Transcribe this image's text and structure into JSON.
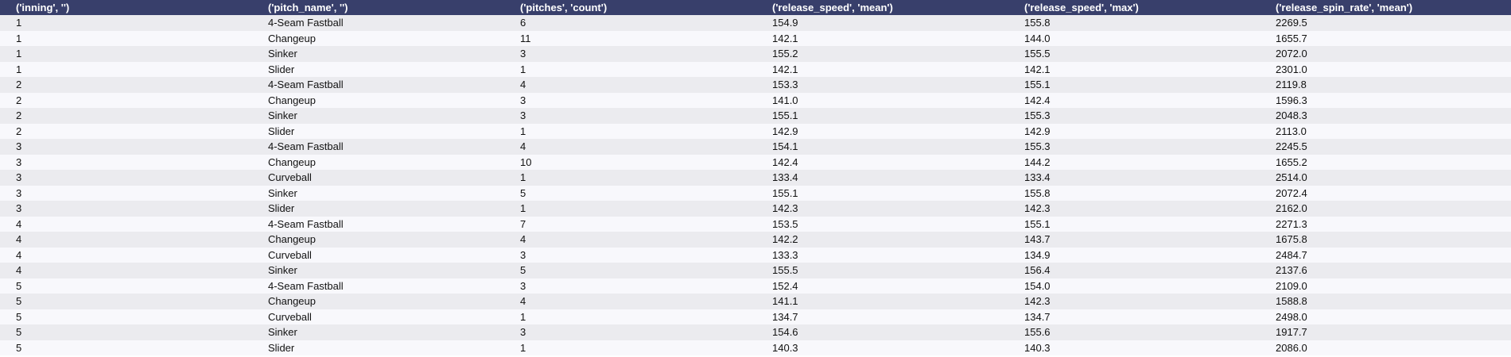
{
  "table": {
    "columns": [
      "('inning', '')",
      "('pitch_name', '')",
      "('pitches', 'count')",
      "('release_speed', 'mean')",
      "('release_speed', 'max')",
      "('release_spin_rate', 'mean')"
    ],
    "rows": [
      [
        "1",
        "4-Seam Fastball",
        "6",
        "154.9",
        "155.8",
        "2269.5"
      ],
      [
        "1",
        "Changeup",
        "11",
        "142.1",
        "144.0",
        "1655.7"
      ],
      [
        "1",
        "Sinker",
        "3",
        "155.2",
        "155.5",
        "2072.0"
      ],
      [
        "1",
        "Slider",
        "1",
        "142.1",
        "142.1",
        "2301.0"
      ],
      [
        "2",
        "4-Seam Fastball",
        "4",
        "153.3",
        "155.1",
        "2119.8"
      ],
      [
        "2",
        "Changeup",
        "3",
        "141.0",
        "142.4",
        "1596.3"
      ],
      [
        "2",
        "Sinker",
        "3",
        "155.1",
        "155.3",
        "2048.3"
      ],
      [
        "2",
        "Slider",
        "1",
        "142.9",
        "142.9",
        "2113.0"
      ],
      [
        "3",
        "4-Seam Fastball",
        "4",
        "154.1",
        "155.3",
        "2245.5"
      ],
      [
        "3",
        "Changeup",
        "10",
        "142.4",
        "144.2",
        "1655.2"
      ],
      [
        "3",
        "Curveball",
        "1",
        "133.4",
        "133.4",
        "2514.0"
      ],
      [
        "3",
        "Sinker",
        "5",
        "155.1",
        "155.8",
        "2072.4"
      ],
      [
        "3",
        "Slider",
        "1",
        "142.3",
        "142.3",
        "2162.0"
      ],
      [
        "4",
        "4-Seam Fastball",
        "7",
        "153.5",
        "155.1",
        "2271.3"
      ],
      [
        "4",
        "Changeup",
        "4",
        "142.2",
        "143.7",
        "1675.8"
      ],
      [
        "4",
        "Curveball",
        "3",
        "133.3",
        "134.9",
        "2484.7"
      ],
      [
        "4",
        "Sinker",
        "5",
        "155.5",
        "156.4",
        "2137.6"
      ],
      [
        "5",
        "4-Seam Fastball",
        "3",
        "152.4",
        "154.0",
        "2109.0"
      ],
      [
        "5",
        "Changeup",
        "4",
        "141.1",
        "142.3",
        "1588.8"
      ],
      [
        "5",
        "Curveball",
        "1",
        "134.7",
        "134.7",
        "2498.0"
      ],
      [
        "5",
        "Sinker",
        "3",
        "154.6",
        "155.6",
        "1917.7"
      ],
      [
        "5",
        "Slider",
        "1",
        "140.3",
        "140.3",
        "2086.0"
      ]
    ]
  },
  "colors": {
    "header_bg": "#383f6b",
    "header_text": "#ffffff",
    "row_odd": "#ebebef",
    "row_even": "#f8f8fc"
  }
}
